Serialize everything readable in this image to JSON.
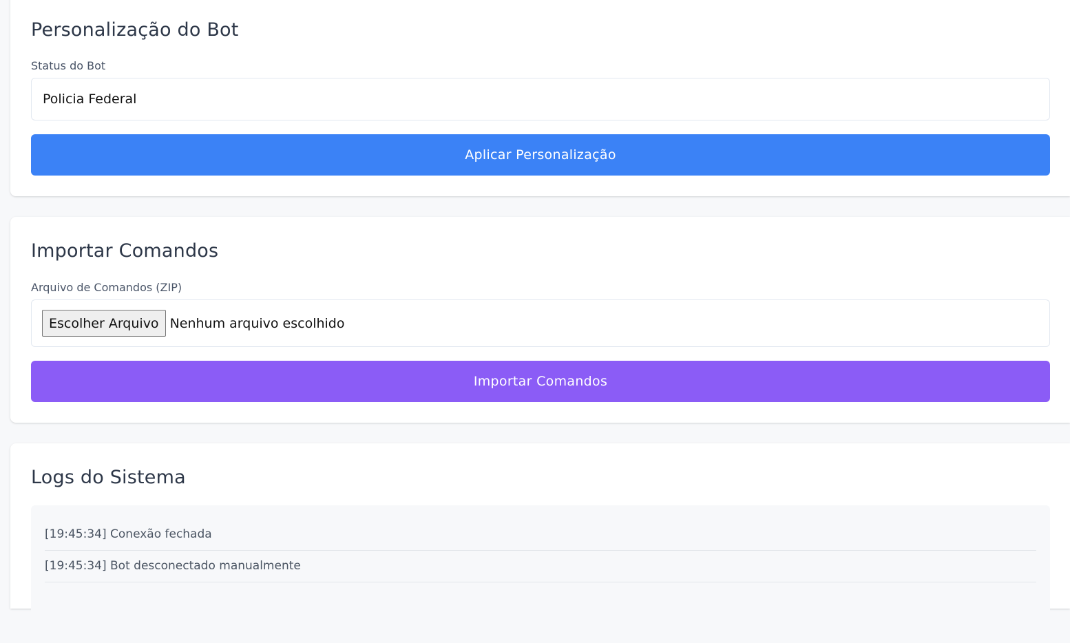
{
  "personalization": {
    "title": "Personalização do Bot",
    "status_label": "Status do Bot",
    "status_value": "Policia Federal",
    "apply_button": "Aplicar Personalização"
  },
  "import": {
    "title": "Importar Comandos",
    "file_label": "Arquivo de Comandos (ZIP)",
    "choose_button": "Escolher Arquivo",
    "file_status": "Nenhum arquivo escolhido",
    "import_button": "Importar Comandos"
  },
  "logs": {
    "title": "Logs do Sistema",
    "entries": [
      "[19:45:34] Conexão fechada",
      "[19:45:34] Bot desconectado manualmente"
    ]
  },
  "colors": {
    "apply_button": "#3b82f6",
    "import_button": "#8b5cf6"
  }
}
